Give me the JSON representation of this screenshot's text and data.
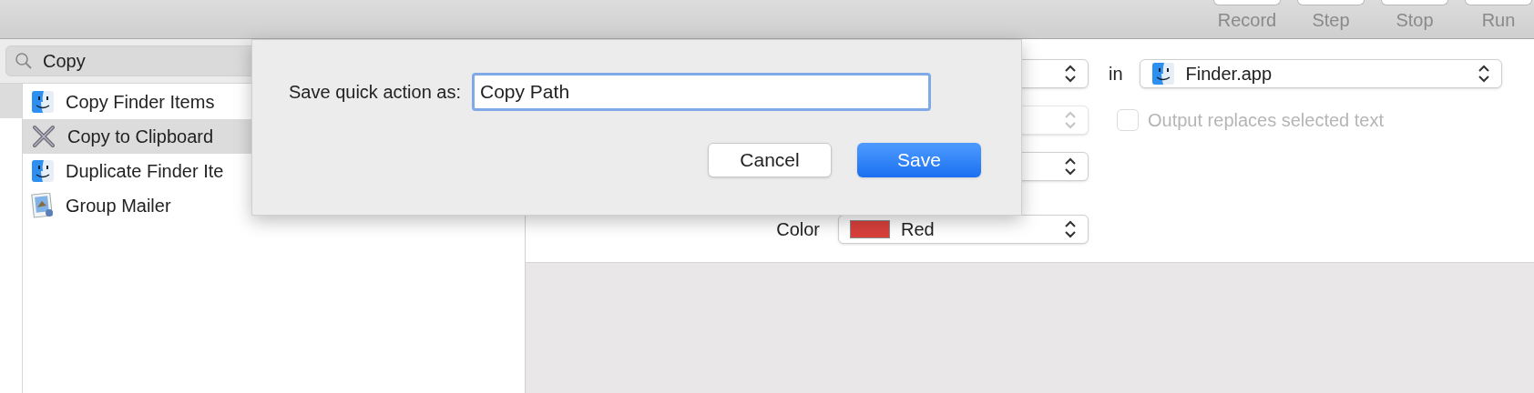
{
  "toolbar": {
    "buttons": [
      {
        "label": "Record"
      },
      {
        "label": "Step"
      },
      {
        "label": "Stop"
      },
      {
        "label": "Run"
      }
    ]
  },
  "library": {
    "search": {
      "value": "Copy"
    },
    "categories": [
      {
        "selected": true
      }
    ],
    "actions": [
      {
        "name": "Copy Finder Items",
        "kind": "finder",
        "selected": false
      },
      {
        "name": "Copy to Clipboard",
        "kind": "tool",
        "selected": true
      },
      {
        "name": "Duplicate Finder Ite",
        "kind": "finder",
        "selected": false
      },
      {
        "name": "Group Mailer",
        "kind": "mailer",
        "selected": false
      }
    ]
  },
  "workflow": {
    "rows": [
      {
        "kind": "app",
        "disabled": false,
        "connector": "in",
        "app": "Finder.app"
      },
      {
        "kind": "checkbox",
        "disabled": true,
        "checkbox": {
          "label": "Output replaces selected text",
          "checked": false,
          "disabled": true
        }
      },
      {
        "kind": "plain",
        "disabled": false
      },
      {
        "kind": "color",
        "disabled": false,
        "label": "Color",
        "value": "Red",
        "color": "#d8403b"
      }
    ]
  },
  "dialog": {
    "label": "Save quick action as:",
    "value": "Copy Path",
    "buttons": [
      {
        "label": "Cancel",
        "default": false
      },
      {
        "label": "Save",
        "default": true
      }
    ]
  }
}
